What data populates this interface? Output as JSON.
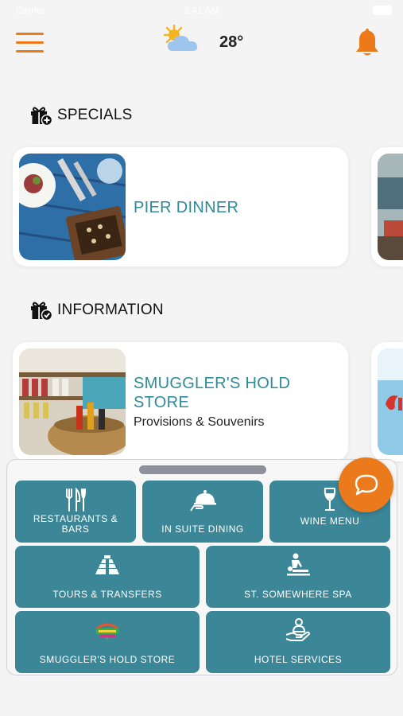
{
  "status_bar": {
    "carrier": "Carrier",
    "time": "9:41 AM"
  },
  "header": {
    "weather_icon": "partly-cloudy-icon",
    "temperature": "28°",
    "accent_color": "#ec7a1a"
  },
  "sections": {
    "specials": {
      "title": "SPECIALS",
      "icon": "gift-plus-icon",
      "cards": [
        {
          "title": "PIER DINNER"
        }
      ]
    },
    "information": {
      "title": "INFORMATION",
      "icon": "gift-check-icon",
      "cards": [
        {
          "title": "SMUGGLER'S HOLD\nSTORE",
          "subtitle": "Provisions & Souvenirs"
        }
      ]
    }
  },
  "quick_menu": {
    "tile_color": "#3b8697",
    "tiles": [
      {
        "label": "RESTAURANTS &\nBARS",
        "icon": "fork-knife-icon"
      },
      {
        "label": "IN SUITE DINING",
        "icon": "cloche-icon"
      },
      {
        "label": "WINE MENU",
        "icon": "wine-glass-icon"
      },
      {
        "label": "TOURS & TRANSFERS",
        "icon": "pyramid-icon"
      },
      {
        "label": "ST. SOMEWHERE SPA",
        "icon": "massage-icon"
      },
      {
        "label": "SMUGGLER'S HOLD STORE",
        "icon": "store-logo-icon"
      },
      {
        "label": "HOTEL SERVICES",
        "icon": "hand-service-icon"
      }
    ]
  },
  "chat": {
    "icon": "chat-bubble-icon"
  }
}
